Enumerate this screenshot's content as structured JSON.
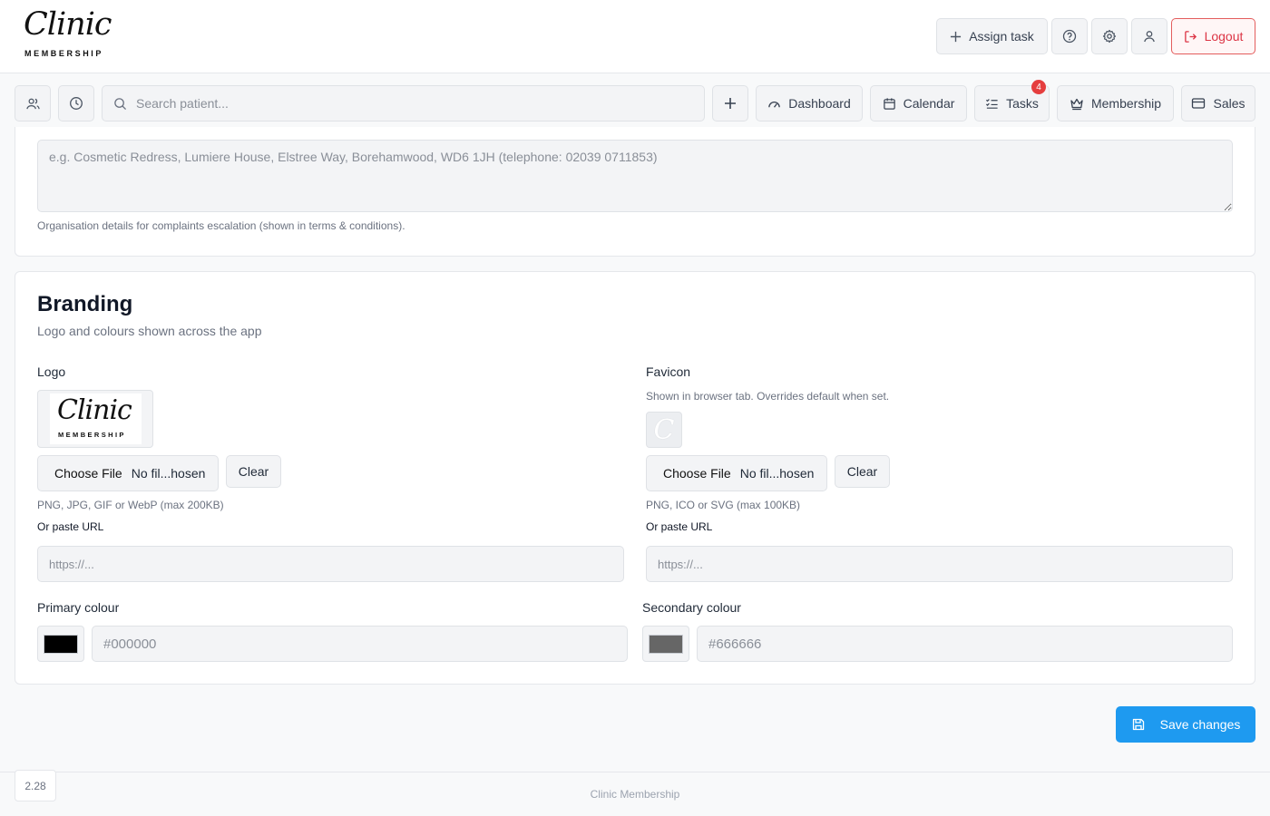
{
  "app": {
    "logo_script": "Clinic",
    "logo_sub": "MEMBERSHIP"
  },
  "topbar": {
    "assign_task_label": "Assign task",
    "logout_label": "Logout"
  },
  "navbar": {
    "search_placeholder": "Search patient...",
    "dashboard_label": "Dashboard",
    "calendar_label": "Calendar",
    "tasks_label": "Tasks",
    "tasks_badge": "4",
    "membership_label": "Membership",
    "sales_label": "Sales"
  },
  "complaints": {
    "placeholder": "e.g. Cosmetic Redress, Lumiere House, Elstree Way, Borehamwood, WD6 1JH (telephone: 02039 0711853)",
    "help": "Organisation details for complaints escalation (shown in terms & conditions)."
  },
  "branding": {
    "title": "Branding",
    "subtitle": "Logo and colours shown across the app",
    "logo": {
      "label": "Logo",
      "choose_label": "Choose File",
      "file_status": "No fil...hosen",
      "clear_label": "Clear",
      "help": "PNG, JPG, GIF or WebP (max 200KB)",
      "url_label": "Or paste URL",
      "url_placeholder": "https://..."
    },
    "favicon": {
      "label": "Favicon",
      "description": "Shown in browser tab. Overrides default when set.",
      "preview_glyph": "C",
      "choose_label": "Choose File",
      "file_status": "No fil...hosen",
      "clear_label": "Clear",
      "help": "PNG, ICO or SVG (max 100KB)",
      "url_label": "Or paste URL",
      "url_placeholder": "https://..."
    },
    "primary": {
      "label": "Primary colour",
      "swatch": "#000000",
      "placeholder": "#000000"
    },
    "secondary": {
      "label": "Secondary colour",
      "swatch": "#666666",
      "placeholder": "#666666"
    }
  },
  "actions": {
    "save_label": "Save changes"
  },
  "footer": {
    "text": "Clinic Membership",
    "version": "2.28"
  },
  "colors": {
    "accent": "#1e9af0",
    "danger": "#dc3545",
    "badge": "#e53e3e"
  }
}
